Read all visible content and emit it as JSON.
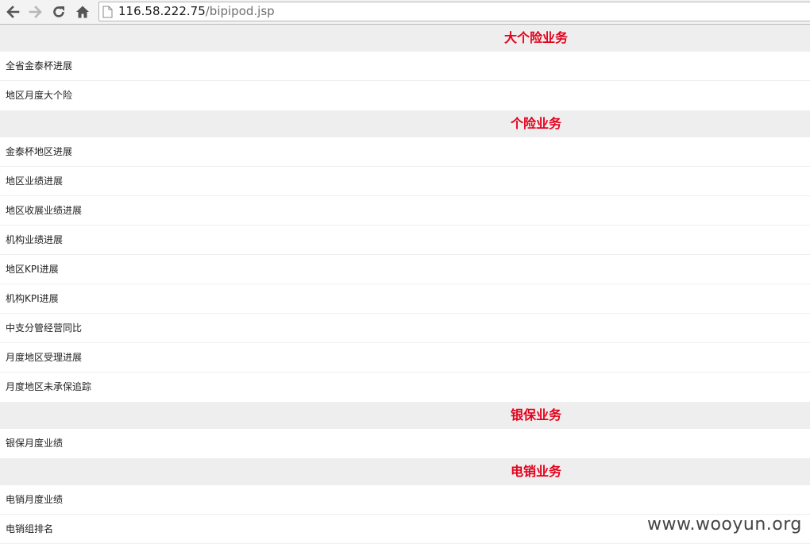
{
  "browser": {
    "url_host": "116.58.222.75",
    "url_path": "/bipipod.jsp"
  },
  "sections": [
    {
      "title": "大个险业务",
      "items": [
        "全省金泰杯进展",
        "地区月度大个险"
      ]
    },
    {
      "title": "个险业务",
      "items": [
        "金泰杯地区进展",
        "地区业绩进展",
        "地区收展业绩进展",
        "机构业绩进展",
        "地区KPI进展",
        "机构KPI进展",
        "中支分管经营同比",
        "月度地区受理进展",
        "月度地区未承保追踪"
      ]
    },
    {
      "title": "银保业务",
      "items": [
        "银保月度业绩"
      ]
    },
    {
      "title": "电销业务",
      "items": [
        "电销月度业绩",
        "电销组排名"
      ]
    }
  ],
  "watermark": "www.wooyun.org",
  "colors": {
    "section_title": "#e3001b",
    "section_bg": "#eeeeee"
  }
}
